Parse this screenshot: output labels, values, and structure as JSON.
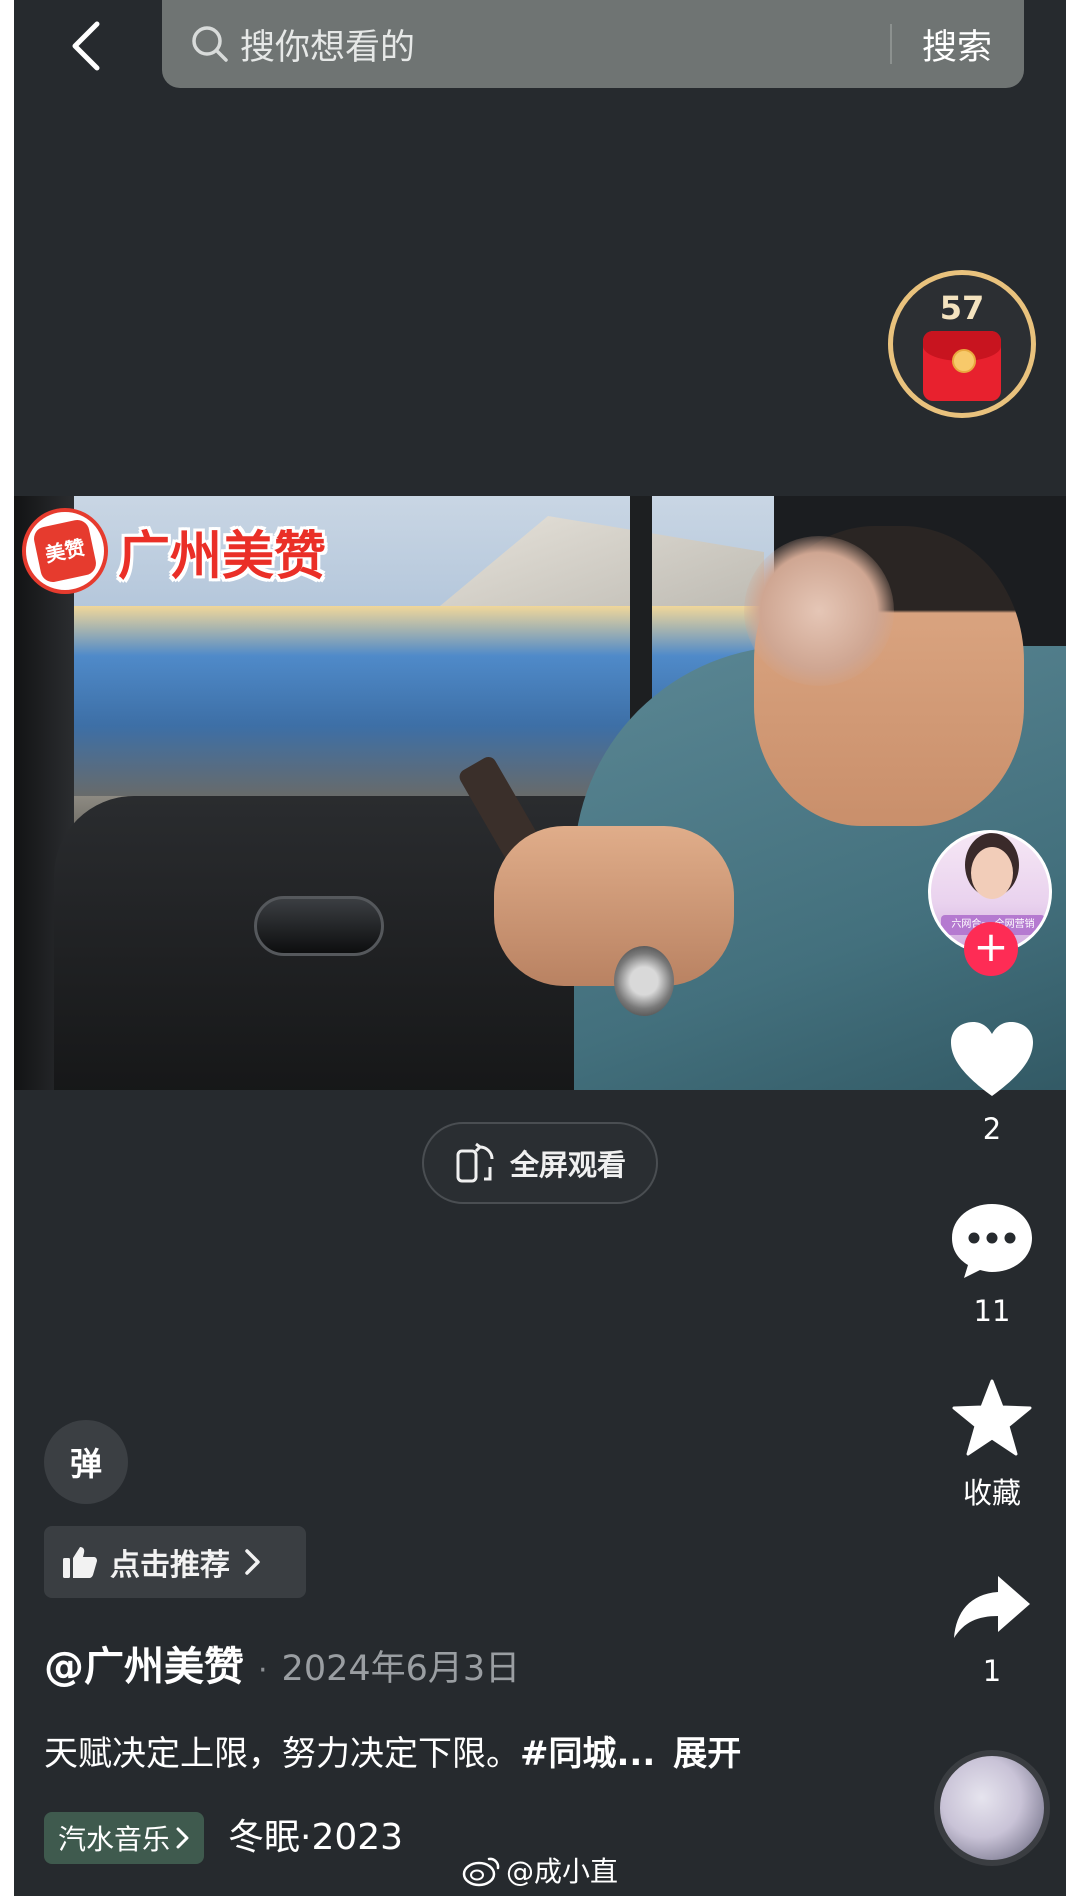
{
  "header": {
    "search_placeholder": "搜你想看的",
    "search_button": "搜索"
  },
  "reward": {
    "countdown": "57"
  },
  "video": {
    "watermark_text": "广州美赞",
    "watermark_logo_text": "美赞",
    "fullscreen_label": "全屏观看"
  },
  "actions": {
    "likes": "2",
    "comments": "11",
    "favorite_label": "收藏",
    "shares": "1"
  },
  "avatar_tag": "六网合一·全网营销",
  "bottom": {
    "danmu_label": "弹",
    "recommend_label": "点击推荐",
    "author": "@广州美赞",
    "date": "2024年6月3日",
    "caption_text": "天赋决定上限，努力决定下限。",
    "caption_hashtag": "#同城...",
    "expand_label": "展开",
    "music_tag": "汽水音乐",
    "song": "冬眠·2023"
  },
  "overlay": {
    "weibo_watermark": "@成小直"
  },
  "colors": {
    "background": "#262a2e",
    "follow_red": "#fe2c55",
    "reward_gold": "#e9c27d",
    "music_tag_bg": "#3f5a4e"
  }
}
